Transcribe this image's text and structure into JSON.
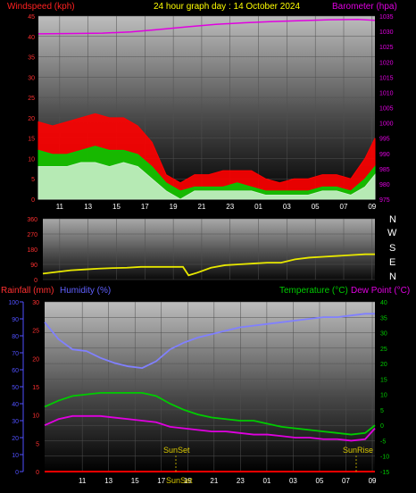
{
  "header": {
    "left": "Windspeed (kph)",
    "center": "24 hour graph day : 14 October 2024",
    "right": "Barometer (hpa)"
  },
  "wind_dir_letters": [
    "N",
    "W",
    "S",
    "E",
    "N"
  ],
  "bottom_header": {
    "rain": "Rainfall (mm)",
    "humidity": "Humidity (%)",
    "temperature": "Temperature (°C)",
    "dewpoint": "Dew Point (°C)"
  },
  "annotations": {
    "sunset": "SunSet",
    "sunrise": "SunRise"
  },
  "colors": {
    "wind_gust": "#ff0000",
    "wind_avg": "#00cc00",
    "wind_low": "#c8f0c8",
    "barometer": "#e000e0",
    "direction": "#e8e800",
    "humidity": "#8080ff",
    "temperature": "#00cc00",
    "dewpoint": "#e000e0",
    "rain": "#ff0000",
    "rain_axis": "#ff3030",
    "humidity_axis": "#5050ff",
    "temp_axis": "#00cc00",
    "grid": "#505050",
    "marker": "#b0a000"
  },
  "chart_data": [
    {
      "type": "line",
      "title": "24 hour graph day : 14 October 2024",
      "x_ticks": [
        "11",
        "13",
        "15",
        "17",
        "19",
        "21",
        "23",
        "01",
        "03",
        "05",
        "07",
        "09"
      ],
      "ylabel_left": "Windspeed (kph)",
      "ylim_left": [
        0,
        45
      ],
      "yticks_left": [
        0,
        5,
        10,
        15,
        20,
        25,
        30,
        35,
        40,
        45
      ],
      "ylabel_right": "Barometer (hpa)",
      "ylim_right": [
        975,
        1035
      ],
      "yticks_right": [
        975,
        980,
        985,
        990,
        995,
        1000,
        1005,
        1010,
        1015,
        1020,
        1025,
        1030,
        1035
      ],
      "series": [
        {
          "name": "Barometer (hpa)",
          "axis": "right",
          "x": [
            9.5,
            12,
            14,
            16,
            18,
            20,
            22,
            24,
            26,
            28,
            30,
            32,
            33.2
          ],
          "values": [
            1029.2,
            1029.3,
            1029.4,
            1029.8,
            1030.6,
            1031.5,
            1032.3,
            1032.8,
            1033.2,
            1033.5,
            1033.8,
            1033.9,
            1033.6
          ]
        },
        {
          "axis": "left",
          "x": [
            9.5,
            10.5,
            11.5,
            12.5,
            13.5,
            14.5,
            15.5,
            16.5,
            17.5,
            18.5,
            19.5,
            20.5,
            21.5,
            22.5,
            23.5,
            24.5,
            25.5,
            26.5,
            27.5,
            28.5,
            29.5,
            30.5,
            31.5,
            32.5,
            33.2
          ],
          "values": [
            19,
            18,
            19,
            20,
            21,
            20,
            20,
            18,
            14,
            6,
            4,
            6,
            6,
            7,
            7,
            7,
            5,
            4,
            5,
            5,
            6,
            6,
            5,
            10,
            15
          ]
        },
        {
          "axis": "left",
          "x": [
            9.5,
            10.5,
            11.5,
            12.5,
            13.5,
            14.5,
            15.5,
            16.5,
            17.5,
            18.5,
            19.5,
            20.5,
            21.5,
            22.5,
            23.5,
            24.5,
            25.5,
            26.5,
            27.5,
            28.5,
            29.5,
            30.5,
            31.5,
            32.5,
            33.2
          ],
          "values": [
            12,
            11,
            11,
            12,
            13,
            12,
            12,
            11,
            8,
            4,
            2,
            3,
            3,
            3,
            4,
            3,
            2,
            2,
            2,
            2,
            3,
            3,
            2,
            5,
            8
          ]
        },
        {
          "axis": "left",
          "x": [
            9.5,
            10.5,
            11.5,
            12.5,
            13.5,
            14.5,
            15.5,
            16.5,
            17.5,
            18.5,
            19.5,
            20.5,
            21.5,
            22.5,
            23.5,
            24.5,
            25.5,
            26.5,
            27.5,
            28.5,
            29.5,
            30.5,
            31.5,
            32.5,
            33.2
          ],
          "values": [
            8,
            8,
            8,
            9,
            9,
            8,
            9,
            8,
            5,
            2,
            0,
            2,
            2,
            2,
            2,
            2,
            1,
            1,
            1,
            1,
            2,
            2,
            1,
            3,
            6
          ]
        }
      ]
    },
    {
      "type": "line",
      "x_ticks": [
        "11",
        "13",
        "15",
        "17",
        "19",
        "21",
        "23",
        "01",
        "03",
        "05",
        "07",
        "09"
      ],
      "ylim": [
        0,
        360
      ],
      "yticks": [
        0,
        90,
        180,
        270,
        360
      ],
      "series": [
        {
          "axis": "left",
          "x": [
            9.5,
            10.5,
            11.5,
            12.5,
            13.5,
            14.5,
            15.5,
            16.5,
            17.5,
            18.5,
            19.5,
            19.9,
            20.5,
            21.5,
            22.5,
            23.5,
            24.5,
            25.5,
            26.5,
            27.5,
            28.5,
            29.5,
            30.5,
            31.5,
            32.5,
            33.2
          ],
          "values": [
            35,
            45,
            55,
            60,
            65,
            68,
            70,
            75,
            75,
            75,
            75,
            25,
            40,
            70,
            85,
            90,
            95,
            100,
            100,
            120,
            130,
            135,
            140,
            145,
            150,
            150
          ]
        }
      ]
    },
    {
      "type": "line",
      "x_ticks": [
        "11",
        "13",
        "15",
        "17",
        "19",
        "21",
        "23",
        "01",
        "03",
        "05",
        "07",
        "09"
      ],
      "ylabel_left": "Rainfall (mm)",
      "ylim_left": [
        0,
        30
      ],
      "yticks_left": [
        0,
        5,
        10,
        15,
        20,
        25,
        30
      ],
      "ylabel_left2": "Humidity (%)",
      "ylim_left2": [
        0,
        100
      ],
      "yticks_left2": [
        0,
        10,
        20,
        30,
        40,
        50,
        60,
        70,
        80,
        90,
        100
      ],
      "ylabel_right": "Temperature (°C)",
      "ylim_right": [
        -15,
        40
      ],
      "yticks_right": [
        -15,
        -10,
        -5,
        0,
        5,
        10,
        15,
        20,
        25,
        30,
        35,
        40
      ],
      "series": [
        {
          "name": "Humidity (%)",
          "axis": "left2",
          "x": [
            9.5,
            10.5,
            11.5,
            12.5,
            13.5,
            14.5,
            15.5,
            16.5,
            17.5,
            18.5,
            19.5,
            20.5,
            21.5,
            22.5,
            23.5,
            24.5,
            25.5,
            26.5,
            27.5,
            28.5,
            29.5,
            30.5,
            31.5,
            32.5,
            33.2
          ],
          "values": [
            88,
            78,
            72,
            71,
            67,
            64,
            62,
            61,
            65,
            72,
            76,
            79,
            81,
            83,
            85,
            86,
            87,
            88,
            89,
            90,
            91,
            91,
            92,
            93,
            93
          ]
        },
        {
          "name": "Temperature (°C)",
          "axis": "right",
          "x": [
            9.5,
            10.5,
            11.5,
            12.5,
            13.5,
            14.5,
            15.5,
            16.5,
            17.5,
            18.5,
            19.5,
            20.5,
            21.5,
            22.5,
            23.5,
            24.5,
            25.5,
            26.5,
            27.5,
            28.5,
            29.5,
            30.5,
            31.5,
            32.5,
            33.2
          ],
          "values": [
            6,
            8,
            9.5,
            10,
            10.5,
            10.5,
            10.5,
            10.5,
            9.5,
            7,
            5,
            3.5,
            2.5,
            2,
            1.5,
            1.5,
            0.5,
            -0.5,
            -1,
            -1.5,
            -2,
            -2.5,
            -3,
            -2.5,
            0
          ]
        },
        {
          "name": "Dew Point (°C)",
          "axis": "right",
          "x": [
            9.5,
            10.5,
            11.5,
            12.5,
            13.5,
            14.5,
            15.5,
            16.5,
            17.5,
            18.5,
            19.5,
            20.5,
            21.5,
            22.5,
            23.5,
            24.5,
            25.5,
            26.5,
            27.5,
            28.5,
            29.5,
            30.5,
            31.5,
            32.5,
            33.2
          ],
          "values": [
            0,
            2,
            3,
            3,
            3,
            2.5,
            2,
            1.5,
            1,
            -0.5,
            -1,
            -1.5,
            -2,
            -2,
            -2.5,
            -3,
            -3,
            -3.5,
            -4,
            -4,
            -4.5,
            -4.5,
            -5,
            -4.5,
            -1
          ]
        },
        {
          "name": "Rainfall (mm)",
          "axis": "left",
          "x": [
            9.5,
            33.2
          ],
          "values": [
            0,
            0
          ]
        }
      ]
    }
  ]
}
